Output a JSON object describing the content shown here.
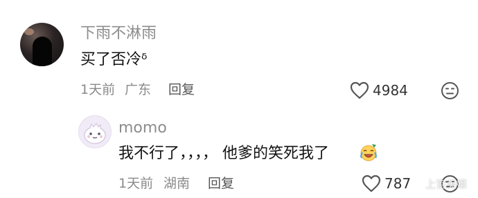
{
  "comments": [
    {
      "username": "下雨不淋雨",
      "text": "买了否冷ᵟ",
      "time": "1天前",
      "location": "广东",
      "reply_label": "回复",
      "likes": "4984"
    },
    {
      "username": "momo",
      "text": "我不行了，，，， 他爹的笑死我了",
      "time": "1天前",
      "location": "湖南",
      "reply_label": "回复",
      "likes": "787"
    }
  ],
  "watermark": "上官美嬢",
  "colors": {
    "username": "#8c8c8c",
    "text": "#111111",
    "meta": "#8a8a8a"
  }
}
